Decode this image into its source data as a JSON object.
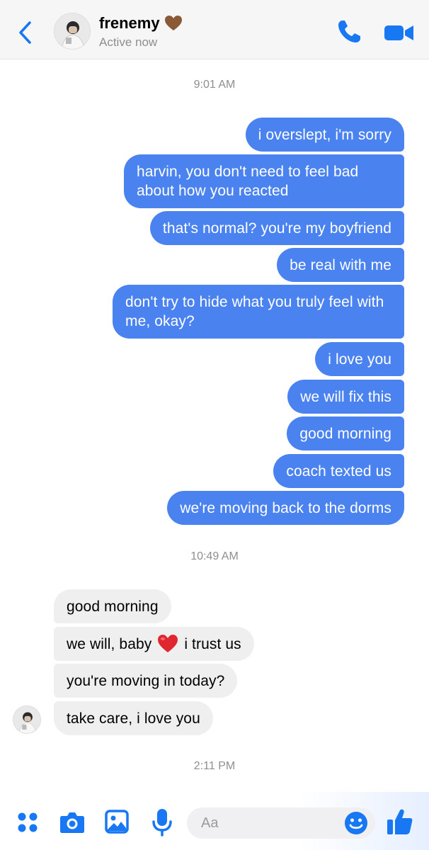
{
  "header": {
    "contact_name": "frenemy",
    "status": "Active now",
    "icons": [
      "chevron-left-icon",
      "brown-heart-icon",
      "phone-icon",
      "video-camera-icon"
    ]
  },
  "timestamps": [
    "9:01 AM",
    "10:49 AM",
    "2:11 PM"
  ],
  "outgoing": [
    "i overslept, i'm sorry",
    "harvin, you don't need to feel bad about how you reacted",
    "that's normal? you're my boyfriend",
    "be real with me",
    "don't try to hide what you truly feel with me, okay?",
    "i love you",
    "we will fix this",
    "good morning",
    "coach texted us",
    "we're moving back to the dorms"
  ],
  "incoming": [
    {
      "before": "good morning"
    },
    {
      "before": "we will, baby",
      "emoji": "red-heart",
      "after": "i trust us"
    },
    {
      "before": "you're moving in today?"
    },
    {
      "before": "take care, i love you"
    }
  ],
  "composer": {
    "placeholder": "Aa",
    "icons": [
      "apps-grid-icon",
      "camera-icon",
      "photo-icon",
      "microphone-icon",
      "emoji-icon",
      "thumbs-up-icon"
    ]
  },
  "colors": {
    "accent": "#1877f2",
    "outgoing_bubble": "#4a82f0",
    "incoming_bubble": "#efefef",
    "timestamp": "#8e8e93"
  }
}
